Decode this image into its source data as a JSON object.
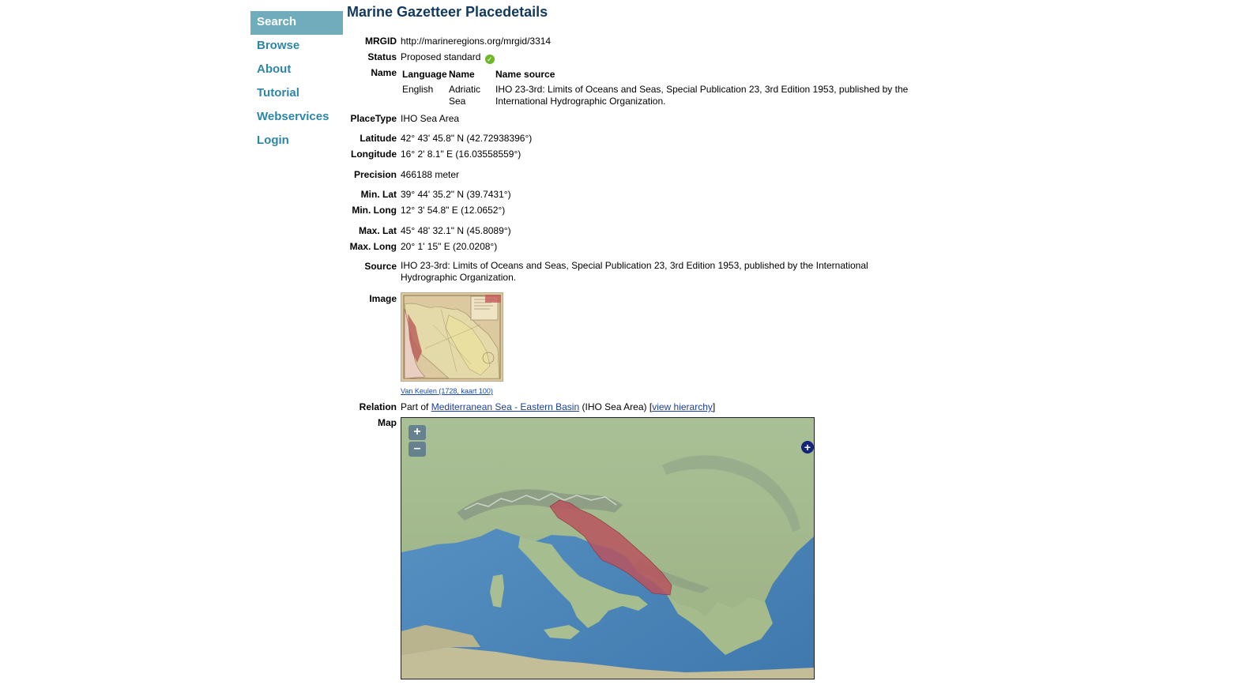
{
  "nav": {
    "items": [
      {
        "label": "Search",
        "active": true
      },
      {
        "label": "Browse"
      },
      {
        "label": "About"
      },
      {
        "label": "Tutorial"
      },
      {
        "label": "Webservices"
      },
      {
        "label": "Login"
      }
    ]
  },
  "title": "Marine Gazetteer Placedetails",
  "details": {
    "mrgid": {
      "label": "MRGID",
      "value": "http://marineregions.org/mrgid/3314"
    },
    "status": {
      "label": "Status",
      "value": "Proposed standard",
      "icon": "check-circle-icon"
    },
    "name": {
      "label": "Name",
      "headers": [
        "Language",
        "Name",
        "Name source"
      ],
      "row": {
        "language": "English",
        "name": "Adriatic Sea",
        "source": "IHO 23-3rd: Limits of Oceans and Seas, Special Publication 23, 3rd Edition 1953, published by the International Hydrographic Organization."
      }
    },
    "placetype": {
      "label": "PlaceType",
      "value": "IHO Sea Area"
    },
    "latitude": {
      "label": "Latitude",
      "value": "42° 43' 45.8\" N (42.72938396°)"
    },
    "longitude": {
      "label": "Longitude",
      "value": "16° 2' 8.1\" E (16.03558559°)"
    },
    "precision": {
      "label": "Precision",
      "value": "466188 meter"
    },
    "min_lat": {
      "label": "Min. Lat",
      "value": "39° 44' 35.2\" N (39.7431°)"
    },
    "min_long": {
      "label": "Min. Long",
      "value": "12° 3' 54.8\" E (12.0652°)"
    },
    "max_lat": {
      "label": "Max. Lat",
      "value": "45° 48' 32.1\" N (45.8089°)"
    },
    "max_long": {
      "label": "Max. Long",
      "value": "20° 1' 15\" E (20.0208°)"
    },
    "source": {
      "label": "Source",
      "value": "IHO 23-3rd: Limits of Oceans and Seas, Special Publication 23, 3rd Edition 1953, published by the International Hydrographic Organization."
    },
    "image": {
      "label": "Image",
      "caption": "Van Keulen (1728, kaart 100)"
    },
    "relation": {
      "label": "Relation",
      "prefix": "Part of",
      "link": "Mediterranean Sea - Eastern Basin",
      "type": "(IHO Sea Area)",
      "hierarchy_link": "view hierarchy"
    },
    "map": {
      "label": "Map",
      "zoom_in": "+",
      "zoom_out": "–",
      "layer_switcher": "+"
    }
  },
  "colors": {
    "nav_active_bg": "#6fadbd",
    "nav_text": "#2e86a6",
    "title": "#12395e",
    "link": "#1a3fa0",
    "polygon": "#b8545e"
  }
}
